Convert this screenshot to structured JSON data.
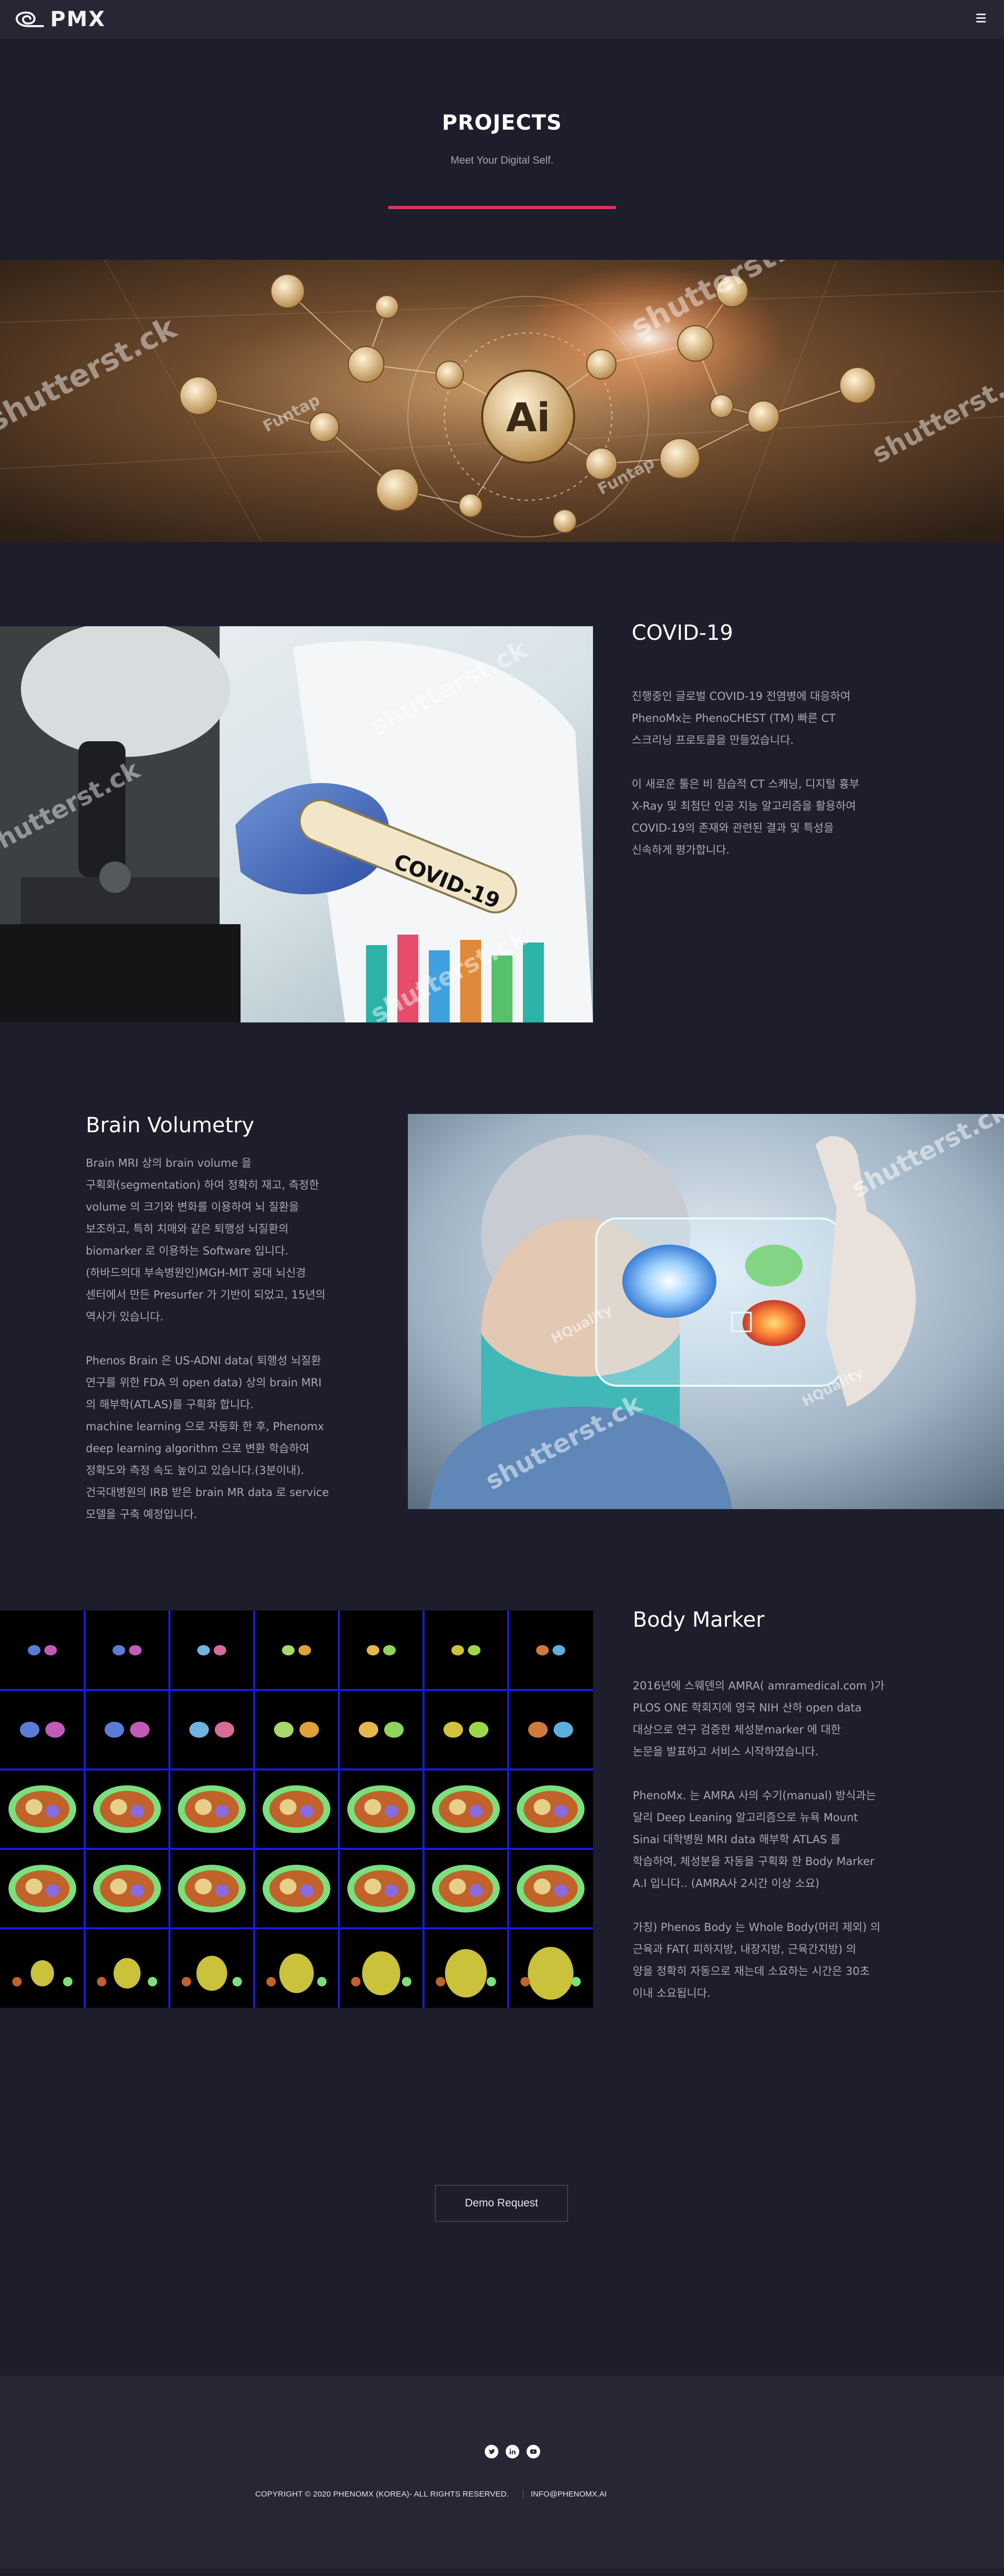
{
  "header": {
    "logo_text": "PMX",
    "menu_icon": "hamburger-icon"
  },
  "intro": {
    "title": "PROJECTS",
    "subtitle": "Meet Your Digital Self.",
    "accent_color": "#e0335a"
  },
  "banner": {
    "watermarks": [
      "shutterst.ck",
      "shutterst.ck",
      "Funtap",
      "Funtap",
      "shutterst.ck"
    ],
    "center_label": "Ai"
  },
  "projects": [
    {
      "title": "COVID-19",
      "paragraphs": [
        "진행중인 글로벌 COVID-19 전염병에 대응하여\nPhenoMx는 PhenoCHEST (TM) 빠른 CT\n스크리닝 프로토콜을 만들었습니다.",
        "이 새로운 툴은 비 침습적 CT 스캐닝, 디지털 흉부\nX-Ray 및 최첨단 인공 지능 알고리즘을 활용하여\nCOVID-19의 존재와 관련된 결과 및 특성을\n신속하게 평가합니다."
      ],
      "image_labels": [
        "COVID-19",
        "shutterst.ck",
        "shutterst.ck",
        "shutterst.ck"
      ]
    },
    {
      "title": "Brain Volumetry",
      "paragraphs": [
        "Brain MRI 상의 brain volume 을\n구획화(segmentation) 하여 정확히 재고, 측정한\nvolume 의 크기와 변화를 이용하여 뇌 질환을\n보조하고, 특히 치매와 같은 퇴행성 뇌질환의\nbiomarker 로 이용하는 Software 입니다.\n(하바드의대 부속병원인)MGH-MIT 공대 뇌신경\n센터에서 만든 Presurfer 가 기반이 되었고, 15년의\n역사가 있습니다.",
        "Phenos Brain 은 US-ADNI data( 퇴행성 뇌질환\n연구를 위한 FDA 의 open data) 상의 brain MRI\n의 해부학(ATLAS)를 구획화 합니다.\nmachine learning 으로 자동화 한 후, Phenomx\ndeep learning algorithm 으로 변환 학습하여\n정확도와 측정 속도 높이고 있습니다.(3분이내).\n건국대병원의 IRB 받은 brain MR data 로 service\n모델을 구축 예정입니다."
      ],
      "image_labels": [
        "shutterst.ck",
        "shutterst.ck",
        "HQuality",
        "HQuality"
      ]
    },
    {
      "title": "Body Marker",
      "paragraphs": [
        "2016년에 스웨덴의 AMRA( amramedical.com )가\nPLOS ONE 학회지에 영국 NIH 산하 open data\n대상으로 연구 검증한 체성분marker 에 대한\n논문을 발표하고 서비스 시작하였습니다.",
        "PhenoMx. 는 AMRA 사의 수기(manual) 방식과는\n달리 Deep Leaning 알고리즘으로 뉴욕 Mount\nSinai 대학병원 MRI data 해부학 ATLAS 를\n학습하여, 체성분을 자동을 구획화 한 Body Marker\nA.I 입니다.. (AMRA사 2시간 이상 소요)",
        "가칭) Phenos Body 는 Whole Body(머리 제외) 의\n근육과 FAT( 피하지방, 내장지방, 근육간지방) 의\n양을 정확히 자동으로 재는데 소요하는 시간은 30초\n이내 소요됩니다."
      ]
    }
  ],
  "demo": {
    "label": "Demo Request"
  },
  "footer": {
    "social": [
      "twitter-icon",
      "linkedin-icon",
      "youtube-icon"
    ],
    "copyright": "COPYRIGHT © 2020 PHENOMX (KOREA)- ALL RIGHTS RESERVED.",
    "email": "INFO@PHENOMX.AI"
  }
}
